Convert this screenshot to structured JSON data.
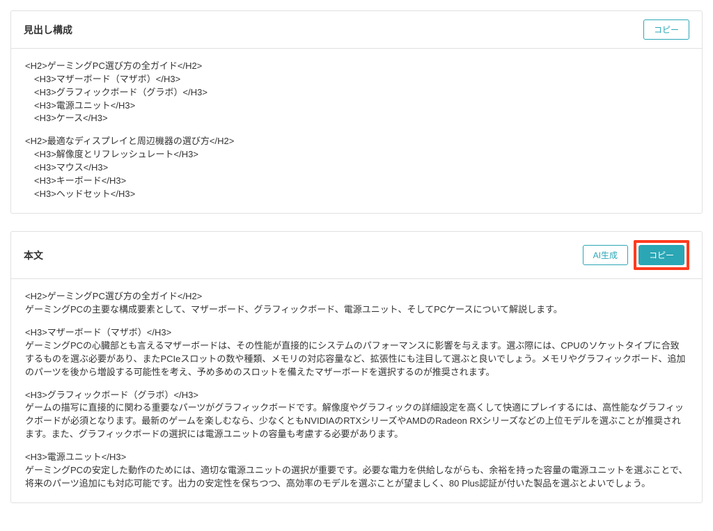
{
  "panels": {
    "headings": {
      "title": "見出し構成",
      "copy_label": "コピー",
      "blocks": [
        {
          "lines": [
            {
              "text": "<H2>ゲーミングPC選び方の全ガイド</H2>",
              "indent": false
            },
            {
              "text": "<H3>マザーボード（マザボ）</H3>",
              "indent": true
            },
            {
              "text": "<H3>グラフィックボード（グラボ）</H3>",
              "indent": true
            },
            {
              "text": "<H3>電源ユニット</H3>",
              "indent": true
            },
            {
              "text": "<H3>ケース</H3>",
              "indent": true
            }
          ]
        },
        {
          "lines": [
            {
              "text": "<H2>最適なディスプレイと周辺機器の選び方</H2>",
              "indent": false
            },
            {
              "text": "<H3>解像度とリフレッシュレート</H3>",
              "indent": true
            },
            {
              "text": "<H3>マウス</H3>",
              "indent": true
            },
            {
              "text": "<H3>キーボード</H3>",
              "indent": true
            },
            {
              "text": "<H3>ヘッドセット</H3>",
              "indent": true
            }
          ]
        }
      ]
    },
    "body": {
      "title": "本文",
      "ai_label": "AI生成",
      "copy_label": "コピー",
      "blocks": [
        {
          "lines": [
            {
              "text": "<H2>ゲーミングPC選び方の全ガイド</H2>"
            },
            {
              "text": "ゲーミングPCの主要な構成要素として、マザーボード、グラフィックボード、電源ユニット、そしてPCケースについて解説します。"
            }
          ]
        },
        {
          "lines": [
            {
              "text": "<H3>マザーボード（マザボ）</H3>"
            },
            {
              "text": "ゲーミングPCの心臓部とも言えるマザーボードは、その性能が直接的にシステムのパフォーマンスに影響を与えます。選ぶ際には、CPUのソケットタイプに合致するものを選ぶ必要があり、またPCIeスロットの数や種類、メモリの対応容量など、拡張性にも注目して選ぶと良いでしょう。メモリやグラフィックボード、追加のパーツを後から増設する可能性を考え、予め多めのスロットを備えたマザーボードを選択するのが推奨されます。"
            }
          ]
        },
        {
          "lines": [
            {
              "text": "<H3>グラフィックボード（グラボ）</H3>"
            },
            {
              "text": "ゲームの描写に直接的に関わる重要なパーツがグラフィックボードです。解像度やグラフィックの詳細設定を高くして快適にプレイするには、高性能なグラフィックボードが必須となります。最新のゲームを楽しむなら、少なくともNVIDIAのRTXシリーズやAMDのRadeon RXシリーズなどの上位モデルを選ぶことが推奨されます。また、グラフィックボードの選択には電源ユニットの容量も考慮する必要があります。"
            }
          ]
        },
        {
          "lines": [
            {
              "text": "<H3>電源ユニット</H3>"
            },
            {
              "text": "ゲーミングPCの安定した動作のためには、適切な電源ユニットの選択が重要です。必要な電力を供給しながらも、余裕を持った容量の電源ユニットを選ぶことで、将来のパーツ追加にも対応可能です。出力の安定性を保ちつつ、高効率のモデルを選ぶことが望ましく、80 Plus認証が付いた製品を選ぶとよいでしょう。"
            }
          ]
        }
      ]
    }
  }
}
